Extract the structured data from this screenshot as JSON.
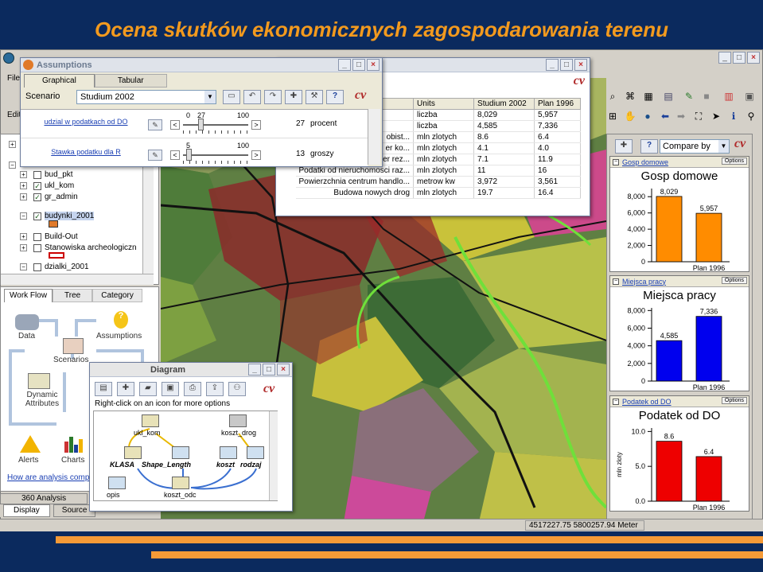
{
  "slide": {
    "title": "Ocena skutków ekonomicznych zagospodarowania terenu",
    "accent_color": "#f39a1e",
    "background": "#0b2a5e"
  },
  "app": {
    "menu": [
      "File",
      "Edit"
    ],
    "status_coords": "4517227.75  5800257.94 Meter"
  },
  "left_panel": {
    "layers": [
      {
        "label": "bud_pkt",
        "checked": false
      },
      {
        "label": "ukl_kom",
        "checked": true
      },
      {
        "label": "gr_admin",
        "checked": true
      },
      {
        "label": "budynki_2001",
        "checked": true
      },
      {
        "label": "Build-Out",
        "checked": false
      },
      {
        "label": "Stanowiska archeologiczn",
        "checked": false
      },
      {
        "label": "dzialki_2001",
        "checked": false
      }
    ],
    "tabs": [
      "Work Flow",
      "Tree",
      "Category"
    ],
    "workflow": {
      "data": "Data",
      "assumptions": "Assumptions",
      "scenarios": "Scenarios",
      "dynamic_attributes": "Dynamic Attributes",
      "alerts": "Alerts",
      "charts": "Charts",
      "help_link": "How are analysis comp"
    },
    "bottom_tab": "360 Analysis",
    "bottom_tabs": [
      "Display",
      "Source"
    ]
  },
  "assumptions": {
    "title": "Assumptions",
    "tabs": [
      "Graphical",
      "Tabular"
    ],
    "scenario_label": "Scenario",
    "scenario_value": "Studium 2002",
    "sliders": [
      {
        "label": "udzial w podatkach od DO",
        "min": "0",
        "current": "27",
        "max": "100",
        "value": "27",
        "unit": "procent",
        "fraction": 0.27
      },
      {
        "label": "Stawka podatku dla R",
        "min": "5",
        "max": "100",
        "value": "13",
        "unit": "groszy",
        "fraction": 0.08
      }
    ]
  },
  "indicators": {
    "headers": [
      "Units",
      "Studium 2002",
      "Plan 1996"
    ],
    "rows": [
      {
        "name": "",
        "units": "liczba",
        "s2002": "8,029",
        "p1996": "5,957"
      },
      {
        "name": "",
        "units": "liczba",
        "s2002": "4,585",
        "p1996": "7,336"
      },
      {
        "name": "obist...",
        "units": "mln zlotych",
        "s2002": "8.6",
        "p1996": "6.4"
      },
      {
        "name": "er ko...",
        "units": "mln zlotych",
        "s2002": "4.1",
        "p1996": "4.0"
      },
      {
        "name": "er rez...",
        "units": "mln zlotych",
        "s2002": "7.1",
        "p1996": "11.9"
      },
      {
        "name": "Podatki od nieruchomosci raz...",
        "units": "mln zlotych",
        "s2002": "11",
        "p1996": "16"
      },
      {
        "name": "Powierzchnia centrum handlo...",
        "units": "metrow kw",
        "s2002": "3,972",
        "p1996": "3,561"
      },
      {
        "name": "Budowa nowych drog",
        "units": "mln zlotych",
        "s2002": "19.7",
        "p1996": "16.4"
      }
    ]
  },
  "diagram": {
    "title": "Diagram",
    "hint": "Right-click on an icon for more options",
    "nodes": [
      "ukl_kom",
      "koszt_drog",
      "KLASA",
      "Shape_Length",
      "koszt",
      "rodzaj",
      "opis",
      "koszt_odc"
    ]
  },
  "charts_panel": {
    "compare_label": "Compare by",
    "options_label": "Options",
    "cards": [
      {
        "link": "Gosp domowe",
        "title": "Gosp domowe",
        "color": "#ff8c00",
        "ymax": 9000,
        "ticks": [
          "8,000",
          "6,000",
          "4,000",
          "2,000",
          "0"
        ],
        "ylabel": "",
        "category": "Plan 1996",
        "bars": [
          {
            "value": 8029,
            "label": "8,029"
          },
          {
            "value": 5957,
            "label": "5,957"
          }
        ]
      },
      {
        "link": "Miejsca pracy",
        "title": "Miejsca pracy",
        "color": "#0000ee",
        "ymax": 8300,
        "ticks": [
          "8,000",
          "6,000",
          "4,000",
          "2,000",
          "0"
        ],
        "ylabel": "",
        "category": "Plan 1996",
        "bars": [
          {
            "value": 4585,
            "label": "4,585"
          },
          {
            "value": 7336,
            "label": "7,336"
          }
        ]
      },
      {
        "link": "Podatek od DO",
        "title": "Podatek od DO",
        "color": "#ee0000",
        "ymax": 10.5,
        "ticks": [
          "10.0",
          "5.0",
          "0.0"
        ],
        "ylabel": "mln zloty",
        "category": "Plan 1996",
        "bars": [
          {
            "value": 8.6,
            "label": "8.6"
          },
          {
            "value": 6.4,
            "label": "6.4"
          }
        ]
      }
    ]
  },
  "chart_data": [
    {
      "type": "bar",
      "title": "Gosp domowe",
      "categories": [
        "",
        "Plan 1996"
      ],
      "values": [
        8029,
        5957
      ],
      "ylim": [
        0,
        9000
      ]
    },
    {
      "type": "bar",
      "title": "Miejsca pracy",
      "categories": [
        "",
        "Plan 1996"
      ],
      "values": [
        4585,
        7336
      ],
      "ylim": [
        0,
        8300
      ]
    },
    {
      "type": "bar",
      "title": "Podatek od DO",
      "categories": [
        "",
        "Plan 1996"
      ],
      "values": [
        8.6,
        6.4
      ],
      "ylabel": "mln zloty",
      "ylim": [
        0,
        10.5
      ]
    }
  ]
}
